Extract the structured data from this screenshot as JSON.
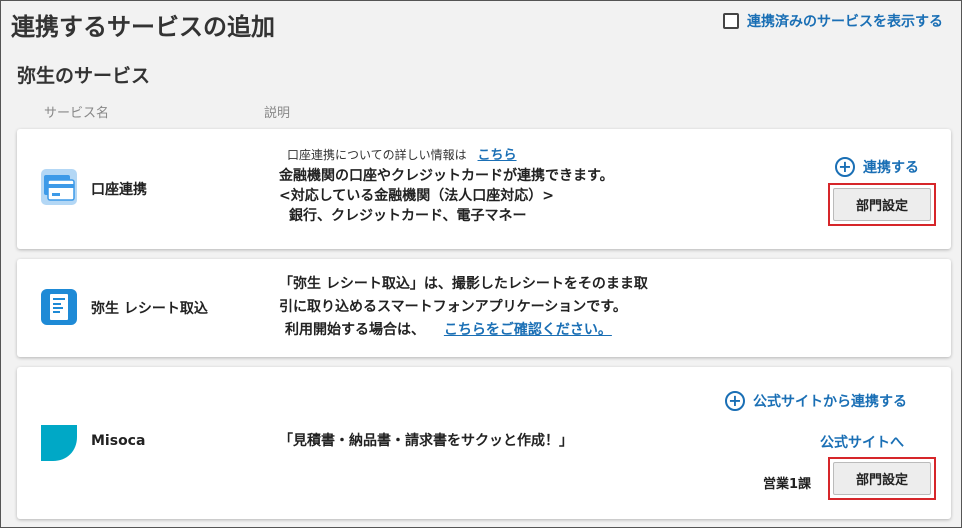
{
  "header": {
    "title": "連携するサービスの追加",
    "show_linked_label": "連携済みのサービスを表示する"
  },
  "section": {
    "title": "弥生のサービス",
    "col_name": "サービス名",
    "col_desc": "説明"
  },
  "services": [
    {
      "name": "口座連携",
      "icon": "bank-card-icon",
      "info_text": "口座連携についての詳しい情報は",
      "info_link": "こちら",
      "desc_lines": [
        "金融機関の口座やクレジットカードが連携できます。",
        "<対応している金融機関（法人口座対応）>",
        "銀行、クレジットカード、電子マネー"
      ],
      "action_label": "連携する",
      "dept_button": "部門設定"
    },
    {
      "name": "弥生 レシート取込",
      "icon": "receipt-app-icon",
      "desc_lines": [
        "「弥生 レシート取込」は、撮影したレシートをそのまま取",
        "引に取り込めるスマートフォンアプリケーションです。",
        "利用開始する場合は、"
      ],
      "desc_link": "こちらをご確認ください。"
    },
    {
      "name": "Misoca",
      "icon": "misoca-logo-icon",
      "desc": "「見積書・納品書・請求書をサクッと作成！」",
      "action_label": "公式サイトから連携する",
      "site_link": "公式サイトへ",
      "dept_label": "営業1課",
      "dept_button": "部門設定"
    }
  ],
  "colors": {
    "link": "#1a6fb5",
    "highlight": "#d6262a"
  }
}
